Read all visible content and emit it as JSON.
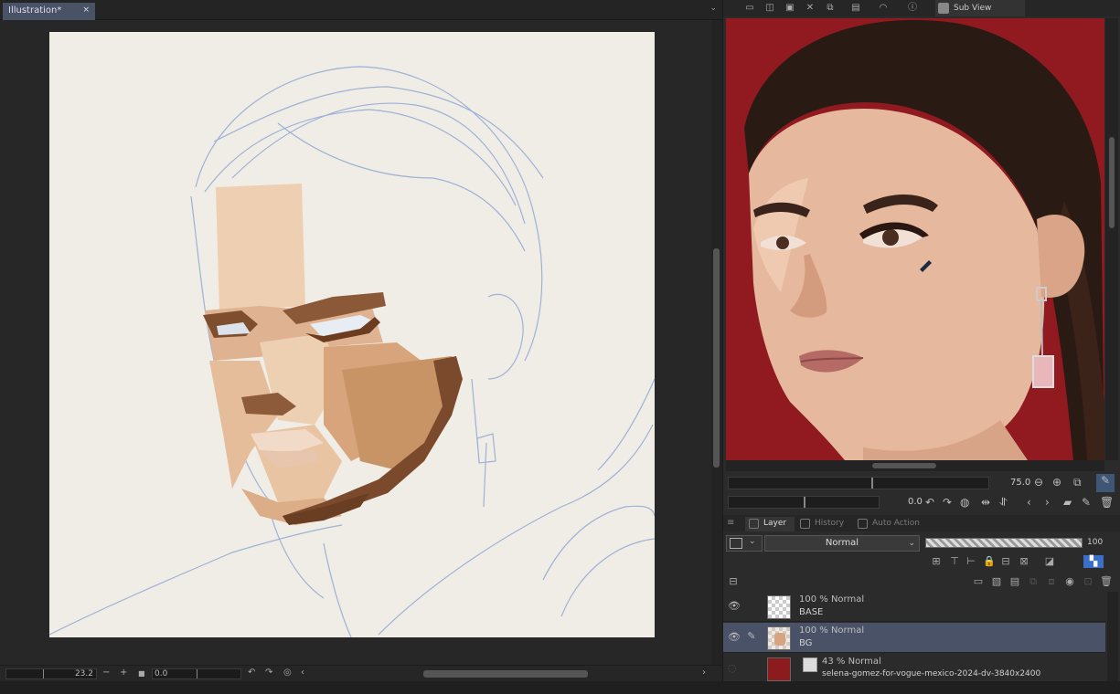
{
  "document": {
    "tab_title": "Illustration*",
    "close_glyph": "×"
  },
  "canvas_status": {
    "zoom": "23.2",
    "angle": "0.0"
  },
  "subview": {
    "tab_label": "Sub View",
    "zoom": "75.0",
    "rotation": "0.0"
  },
  "layer_panel": {
    "tabs": [
      {
        "label": "Layer",
        "icon": "layer-icon"
      },
      {
        "label": "History",
        "icon": "history-icon"
      },
      {
        "label": "Auto Action",
        "icon": "auto-action-icon"
      }
    ],
    "blend_mode": "Normal",
    "opacity": "100",
    "layers": [
      {
        "mode": "100 % Normal",
        "name": "BASE",
        "visible": true,
        "selected": false
      },
      {
        "mode": "100 % Normal",
        "name": "BG",
        "visible": true,
        "selected": true
      },
      {
        "mode": "43 % Normal",
        "name": "selena-gomez-for-vogue-mexico-2024-dv-3840x2400",
        "visible": false,
        "selected": false
      }
    ]
  },
  "colors": {
    "accent": "#4a5268",
    "paper": "#efede6",
    "sketch_line": "#9fb1d6",
    "reference_bg": "#9a1e22"
  }
}
